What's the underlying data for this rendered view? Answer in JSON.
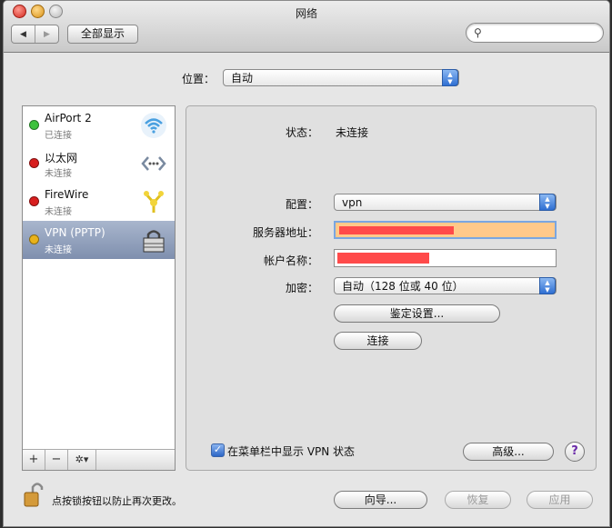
{
  "window": {
    "title": "网络",
    "show_all": "全部显示"
  },
  "location": {
    "label": "位置：",
    "value": "自动"
  },
  "services": [
    {
      "name": "AirPort 2",
      "status": "已连接",
      "dot_color": "#3cc23c",
      "icon": "wifi-icon"
    },
    {
      "name": "以太网",
      "status": "未连接",
      "dot_color": "#d81e1e",
      "icon": "ethernet-icon"
    },
    {
      "name": "FireWire",
      "status": "未连接",
      "dot_color": "#d81e1e",
      "icon": "firewire-icon"
    },
    {
      "name": "VPN (PPTP)",
      "status": "未连接",
      "dot_color": "#e8b21a",
      "icon": "vpn-lock-icon",
      "selected": true
    }
  ],
  "sidebar_buttons": {
    "add": "+",
    "remove": "−",
    "gear": "✲▾"
  },
  "detail": {
    "status_label": "状态：",
    "status_value": "未连接",
    "config_label": "配置：",
    "config_value": "vpn",
    "server_label": "服务器地址：",
    "account_label": "帐户名称：",
    "encryption_label": "加密：",
    "encryption_value": "自动（128 位或 40 位）",
    "auth_button": "鉴定设置...",
    "connect_button": "连接",
    "show_menu_label": "在菜单栏中显示 VPN 状态",
    "advanced_button": "高级...",
    "help_button": "?"
  },
  "footer": {
    "lock_text": "点按锁按钮以防止再次更改。",
    "assist_button": "向导...",
    "revert_button": "恢复",
    "apply_button": "应用"
  },
  "colors": {
    "redaction": "#ff4a4a",
    "server_field_bg": "#ffc98a",
    "selection": "#8594b2"
  }
}
